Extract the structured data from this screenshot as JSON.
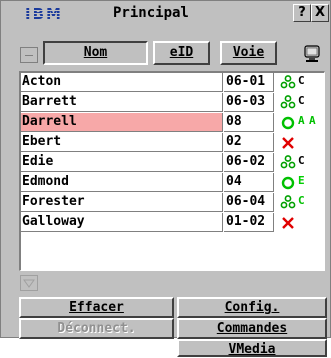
{
  "window": {
    "logo": "IBM",
    "title": "Principal",
    "help_label": "?",
    "close_label": "X"
  },
  "header": {
    "name_label": "Nom",
    "eid_label": "eID",
    "port_label": "Voie"
  },
  "rows": [
    {
      "name": "Acton",
      "port": "06-01",
      "status_icon": "users-icon",
      "channel": "C",
      "channel2": "",
      "ch_color": "#000000"
    },
    {
      "name": "Barrett",
      "port": "06-03",
      "status_icon": "users-icon",
      "channel": "C",
      "channel2": "",
      "ch_color": "#000000"
    },
    {
      "name": "Darrell",
      "port": "08",
      "status_icon": "green-circle-icon",
      "channel": "A",
      "channel2": "A",
      "ch_color": "#00c000",
      "selected": true
    },
    {
      "name": "Ebert",
      "port": "02",
      "status_icon": "red-x-icon",
      "channel": "",
      "channel2": "",
      "ch_color": "#000000"
    },
    {
      "name": "Edie",
      "port": "06-02",
      "status_icon": "users-icon",
      "channel": "C",
      "channel2": "",
      "ch_color": "#000000"
    },
    {
      "name": "Edmond",
      "port": "04",
      "status_icon": "green-circle-icon",
      "channel": "E",
      "channel2": "",
      "ch_color": "#00d000"
    },
    {
      "name": "Forester",
      "port": "06-04",
      "status_icon": "users-icon",
      "channel": "C",
      "channel2": "",
      "ch_color": "#00c000"
    },
    {
      "name": "Galloway",
      "port": "01-02",
      "status_icon": "red-x-icon",
      "channel": "",
      "channel2": "",
      "ch_color": "#000000"
    }
  ],
  "buttons": {
    "clear": "Effacer",
    "config": "Config.",
    "disconnect": "Déconnect.",
    "commands": "Commandes",
    "vmedia": "VMedia"
  },
  "colors": {
    "selected_row": "#f7a8a8",
    "green": "#00c000",
    "red": "#e00000"
  }
}
